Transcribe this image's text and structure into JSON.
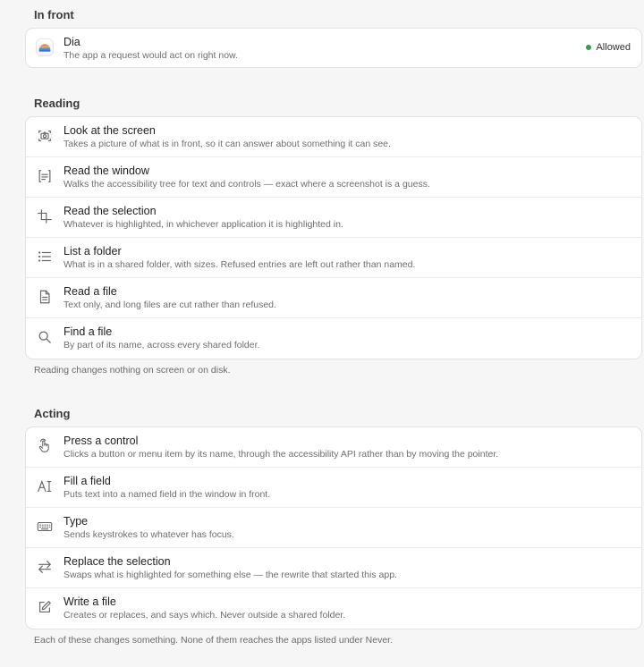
{
  "in_front": {
    "heading": "In front",
    "app": {
      "name": "Dia",
      "description": "The app a request would act on right now.",
      "status": "Allowed",
      "status_color": "#2e9e4f",
      "icon": "dia-app-icon"
    }
  },
  "reading": {
    "heading": "Reading",
    "items": [
      {
        "title": "Look at the screen",
        "description": "Takes a picture of what is in front, so it can answer about something it can see.",
        "icon": "camera-icon"
      },
      {
        "title": "Read the window",
        "description": "Walks the accessibility tree for text and controls — exact where a screenshot is a guess.",
        "icon": "window-text-icon"
      },
      {
        "title": "Read the selection",
        "description": "Whatever is highlighted, in whichever application it is highlighted in.",
        "icon": "crop-icon"
      },
      {
        "title": "List a folder",
        "description": "What is in a shared folder, with sizes. Refused entries are left out rather than named.",
        "icon": "list-icon"
      },
      {
        "title": "Read a file",
        "description": "Text only, and long files are cut rather than refused.",
        "icon": "document-icon"
      },
      {
        "title": "Find a file",
        "description": "By part of its name, across every shared folder.",
        "icon": "search-icon"
      }
    ],
    "note": "Reading changes nothing on screen or on disk."
  },
  "acting": {
    "heading": "Acting",
    "items": [
      {
        "title": "Press a control",
        "description": "Clicks a button or menu item by its name, through the accessibility API rather than by moving the pointer.",
        "icon": "hand-pointer-icon"
      },
      {
        "title": "Fill a field",
        "description": "Puts text into a named field in the window in front.",
        "icon": "text-cursor-icon"
      },
      {
        "title": "Type",
        "description": "Sends keystrokes to whatever has focus.",
        "icon": "keyboard-icon"
      },
      {
        "title": "Replace the selection",
        "description": "Swaps what is highlighted for something else — the rewrite that started this app.",
        "icon": "swap-arrows-icon"
      },
      {
        "title": "Write a file",
        "description": "Creates or replaces, and says which. Never outside a shared folder.",
        "icon": "edit-icon"
      }
    ],
    "note": "Each of these changes something. None of them reaches the apps listed under Never."
  }
}
